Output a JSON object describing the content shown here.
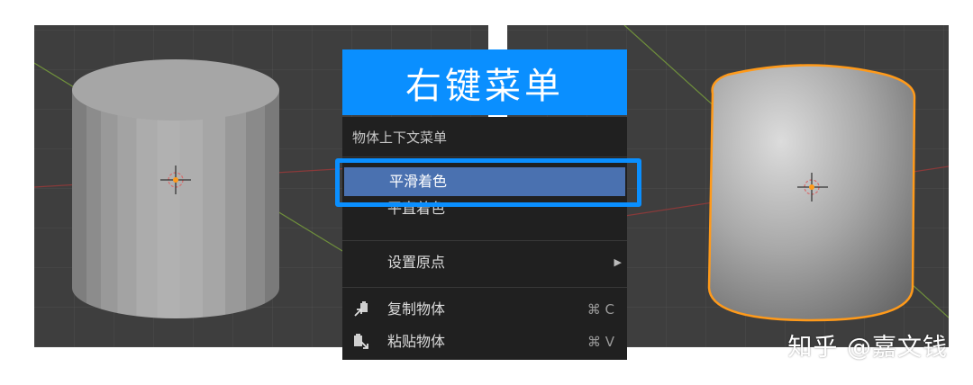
{
  "banner": {
    "title": "右键菜单"
  },
  "context_menu": {
    "title": "物体上下文菜单",
    "items": [
      {
        "label": "平滑着色",
        "state": "highlighted"
      },
      {
        "label": "平直着色"
      },
      {
        "label": "设置原点",
        "submenu_arrow": "▶"
      },
      {
        "label": "复制物体",
        "shortcut": "⌘ C",
        "icon": "copy-objects-icon"
      },
      {
        "label": "粘贴物体",
        "shortcut": "⌘ V",
        "icon": "paste-objects-icon"
      }
    ]
  },
  "watermark": "知乎 @嘉文钱",
  "colors": {
    "banner": "#0a8fff",
    "menu_bg": "#202020",
    "highlight": "#4a71b0",
    "selection_outline": "#ff9a1a",
    "viewport_bg": "#3e3e3e"
  }
}
